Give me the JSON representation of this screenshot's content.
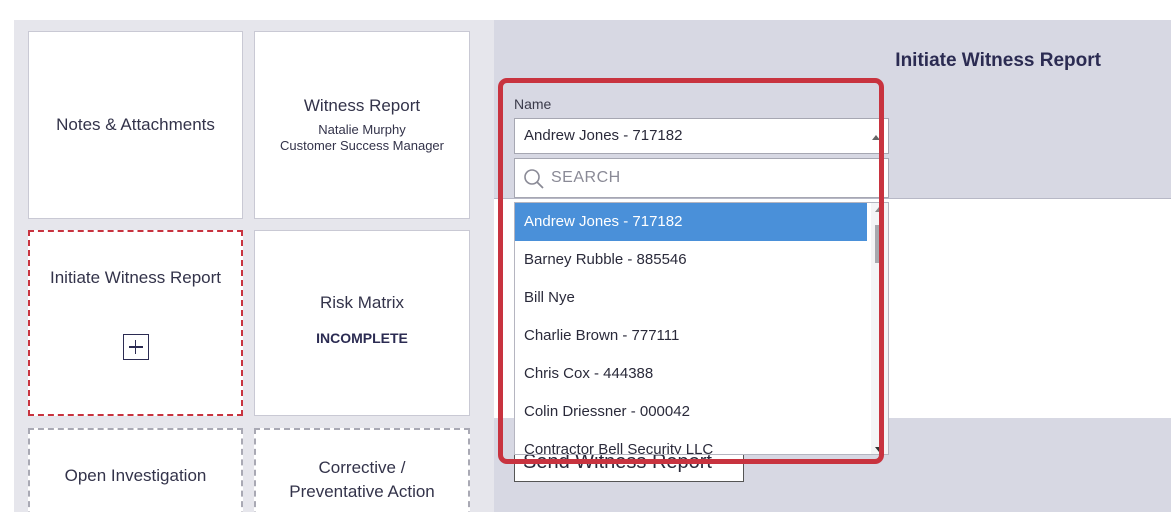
{
  "tiles": {
    "notes": {
      "title": "Notes & Attachments"
    },
    "witness": {
      "title": "Witness Report",
      "name": "Natalie Murphy",
      "role": "Customer Success Manager"
    },
    "initiate": {
      "title": "Initiate Witness Report",
      "icon": "plus-box-icon"
    },
    "risk": {
      "title": "Risk Matrix",
      "status": "INCOMPLETE"
    },
    "investigation": {
      "title": "Open Investigation"
    },
    "corrective": {
      "title": "Corrective /",
      "title_line2": "Preventative Action"
    }
  },
  "form": {
    "title": "Initiate Witness Report",
    "name_label": "Name",
    "selected_value": "Andrew Jones - 717182",
    "search_placeholder": "SEARCH",
    "send_button": "Send Witness Report"
  },
  "dropdown": {
    "options": [
      "Andrew Jones - 717182",
      "Barney Rubble - 885546",
      "Bill Nye",
      "Charlie Brown - 777111",
      "Chris Cox - 444388",
      "Colin Driessner - 000042",
      "Contractor Bell Security LLC"
    ],
    "selected_index": 0
  },
  "colors": {
    "highlight": "#c8333f",
    "selected_option": "#4a90d9",
    "title_text": "#2b2b52",
    "panel_bg": "#d7d8e3"
  }
}
